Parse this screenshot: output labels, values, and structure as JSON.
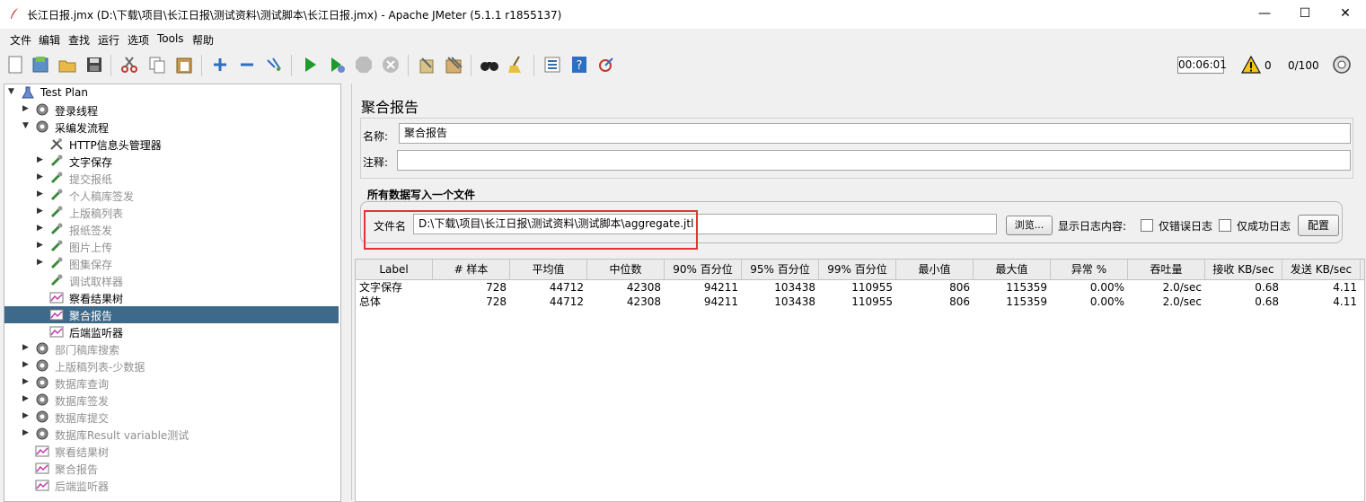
{
  "window": {
    "title": "长江日报.jmx (D:\\下载\\项目\\长江日报\\测试资料\\测试脚本\\长江日报.jmx) - Apache JMeter (5.1.1 r1855137)",
    "minimize": "—",
    "maximize": "☐",
    "close": "✕"
  },
  "menu": [
    "文件",
    "编辑",
    "查找",
    "运行",
    "选项",
    "Tools",
    "帮助"
  ],
  "toolbar": {
    "timer": "00:06:01",
    "warning_count": "0",
    "thread_count": "0/100"
  },
  "tree": [
    {
      "label": "Test Plan",
      "depth": 0,
      "arrow": "▼",
      "icon": "test-plan-icon",
      "state": "normal"
    },
    {
      "label": "登录线程",
      "depth": 1,
      "arrow": "▶",
      "icon": "gear-icon",
      "state": "normal"
    },
    {
      "label": "采编发流程",
      "depth": 1,
      "arrow": "▼",
      "icon": "gear-icon",
      "state": "normal"
    },
    {
      "label": "HTTP信息头管理器",
      "depth": 2,
      "arrow": "",
      "icon": "tools-icon",
      "state": "normal"
    },
    {
      "label": "文字保存",
      "depth": 2,
      "arrow": "▶",
      "icon": "pipette-icon",
      "state": "normal"
    },
    {
      "label": "提交报纸",
      "depth": 2,
      "arrow": "▶",
      "icon": "pipette-icon",
      "state": "disabled"
    },
    {
      "label": "个人稿库签发",
      "depth": 2,
      "arrow": "▶",
      "icon": "pipette-icon",
      "state": "disabled"
    },
    {
      "label": "上版稿列表",
      "depth": 2,
      "arrow": "▶",
      "icon": "pipette-icon",
      "state": "disabled"
    },
    {
      "label": "报纸签发",
      "depth": 2,
      "arrow": "▶",
      "icon": "pipette-icon",
      "state": "disabled"
    },
    {
      "label": "图片上传",
      "depth": 2,
      "arrow": "▶",
      "icon": "pipette-icon",
      "state": "disabled"
    },
    {
      "label": "图集保存",
      "depth": 2,
      "arrow": "▶",
      "icon": "pipette-icon",
      "state": "disabled"
    },
    {
      "label": "调试取样器",
      "depth": 2,
      "arrow": "",
      "icon": "pipette-icon",
      "state": "disabled"
    },
    {
      "label": "察看结果树",
      "depth": 2,
      "arrow": "",
      "icon": "listener-icon",
      "state": "normal"
    },
    {
      "label": "聚合报告",
      "depth": 2,
      "arrow": "",
      "icon": "listener-icon",
      "state": "selected"
    },
    {
      "label": "后端监听器",
      "depth": 2,
      "arrow": "",
      "icon": "listener-icon",
      "state": "normal"
    },
    {
      "label": "部门稿库搜索",
      "depth": 1,
      "arrow": "▶",
      "icon": "gear-icon",
      "state": "disabled"
    },
    {
      "label": "上版稿列表-少数据",
      "depth": 1,
      "arrow": "▶",
      "icon": "gear-icon",
      "state": "disabled"
    },
    {
      "label": "数据库查询",
      "depth": 1,
      "arrow": "▶",
      "icon": "gear-icon",
      "state": "disabled"
    },
    {
      "label": "数据库签发",
      "depth": 1,
      "arrow": "▶",
      "icon": "gear-icon",
      "state": "disabled"
    },
    {
      "label": "数据库提交",
      "depth": 1,
      "arrow": "▶",
      "icon": "gear-icon",
      "state": "disabled"
    },
    {
      "label": "数据库Result variable测试",
      "depth": 1,
      "arrow": "▶",
      "icon": "gear-icon",
      "state": "disabled"
    },
    {
      "label": "察看结果树",
      "depth": 1,
      "arrow": "",
      "icon": "listener-icon",
      "state": "disabled"
    },
    {
      "label": "聚合报告",
      "depth": 1,
      "arrow": "",
      "icon": "listener-icon",
      "state": "disabled"
    },
    {
      "label": "后端监听器",
      "depth": 1,
      "arrow": "",
      "icon": "listener-icon",
      "state": "disabled"
    }
  ],
  "panel": {
    "title": "聚合报告",
    "name_label": "名称:",
    "name_value": "聚合报告",
    "comment_label": "注释:",
    "comment_value": "",
    "file_section_title": "所有数据写入一个文件",
    "file_label": "文件名",
    "file_value": "D:\\下载\\项目\\长江日报\\测试资料\\测试脚本\\aggregate.jtl",
    "browse_button": "浏览...",
    "log_label": "显示日志内容:",
    "errors_only_label": "仅错误日志",
    "success_only_label": "仅成功日志",
    "configure_button": "配置"
  },
  "table": {
    "headers": [
      "Label",
      "# 样本",
      "平均值",
      "中位数",
      "90% 百分位",
      "95% 百分位",
      "99% 百分位",
      "最小值",
      "最大值",
      "异常 %",
      "吞吐量",
      "接收 KB/sec",
      "发送 KB/sec"
    ],
    "rows": [
      [
        "文字保存",
        "728",
        "44712",
        "42308",
        "94211",
        "103438",
        "110955",
        "806",
        "115359",
        "0.00%",
        "2.0/sec",
        "0.68",
        "4.11"
      ],
      [
        "总体",
        "728",
        "44712",
        "42308",
        "94211",
        "103438",
        "110955",
        "806",
        "115359",
        "0.00%",
        "2.0/sec",
        "0.68",
        "4.11"
      ]
    ]
  }
}
